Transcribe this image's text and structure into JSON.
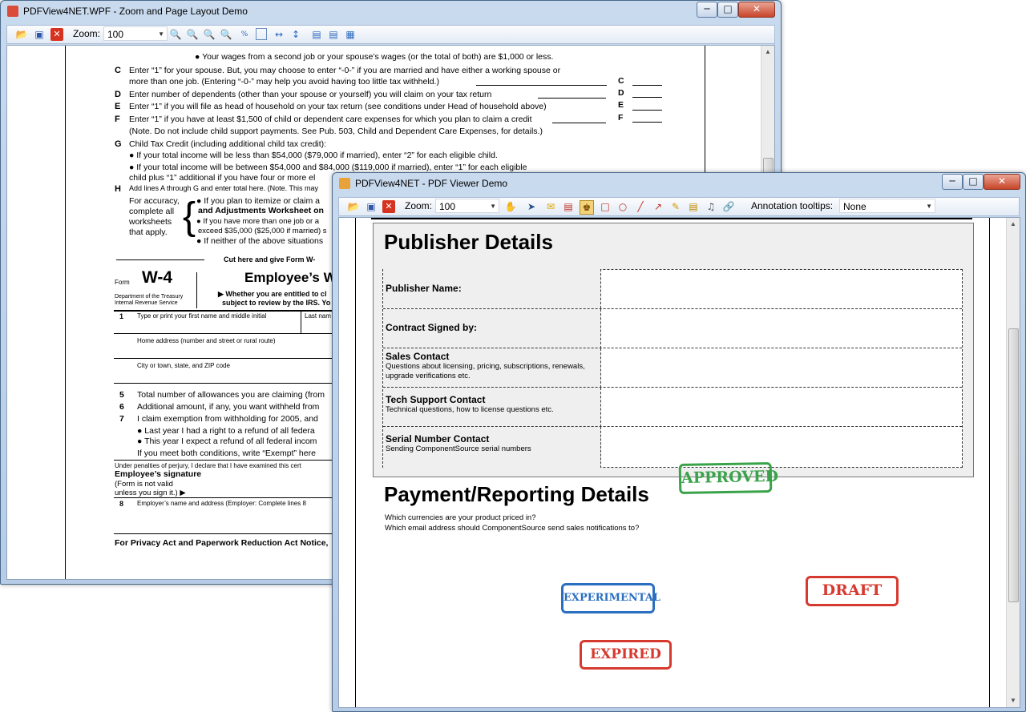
{
  "back_window": {
    "title": "PDFView4NET.WPF - Zoom and Page Layout Demo",
    "controls": {
      "minimize": "─",
      "maximize": "□",
      "close": "✕"
    },
    "toolbar": {
      "zoom_label": "Zoom:",
      "zoom_value": "100"
    },
    "w4": {
      "top_line": "●  Your wages from a second job or your spouse’s wages (or the total of both) are $1,000 or less.",
      "C1": "Enter “1” for your spouse. But, you may choose to enter “-0-” if you are married and have either a working spouse or",
      "C2": "more than one job. (Entering “-0-” may help you avoid having too little tax withheld.)",
      "D": "Enter number of dependents (other than your spouse or yourself) you will claim on your tax return",
      "E": "Enter “1” if you will file as head of household on your tax return (see conditions under Head of household above)",
      "F1": "Enter “1” if you have at least $1,500 of child or dependent care expenses for which you plan to claim a credit",
      "F2": "(Note. Do not include child support payments. See Pub. 503, Child and Dependent Care Expenses, for details.)",
      "G1": "Child Tax Credit (including additional child tax credit):",
      "G2": "●  If your total income will be less than $54,000 ($79,000 if married), enter “2” for each eligible child.",
      "G3": "●  If your total income will be between $54,000 and $84,000 ($119,000 if married), enter “1” for each eligible",
      "G4": "child plus “1” additional if you have four or more el",
      "H": "Add lines A through G and enter total here. (Note. This may",
      "acc1": "For accuracy,",
      "acc2": "complete all",
      "acc3": "worksheets",
      "acc4": "that apply.",
      "b1": "● If you plan to itemize or claim a",
      "b1b": "and Adjustments Worksheet on",
      "b2": "● If you have more than one job or a",
      "b2b": "exceed $35,000 ($25,000 if married) s",
      "b3": "● If neither of the above situations",
      "cut": "Cut here and give Form W-",
      "form_word": "Form",
      "form_id": "W-4",
      "form_title": "Employee’s W",
      "dept1": "Department of the Treasury",
      "dept2": "Internal Revenue Service",
      "whether1": "▶  Whether you are entitled to cl",
      "whether2": "subject to review by the IRS. Yo",
      "f1": "Type or print your first name and middle initial",
      "f1b": "Last nam",
      "home": "Home address (number and street or rural route)",
      "city": "City or town, state, and ZIP code",
      "l5": "Total number of allowances you are claiming (from",
      "l6": "Additional amount, if any, you want withheld from",
      "l7": "I claim exemption from withholding for 2005, and",
      "l7a": "● Last year I had a right to a refund of all federa",
      "l7b": "● This year I expect a refund of all federal incom",
      "l7c": "If you meet both conditions, write “Exempt” here",
      "perjury": "Under penalties of perjury, I declare that I have examined this cert",
      "sig": "Employee’s signature",
      "sig2": "(Form is not valid",
      "sig3": "unless you sign it.)  ▶",
      "l8": "Employer’s name and address (Employer: Complete lines 8",
      "privacy": "For Privacy Act and Paperwork Reduction Act Notice,",
      "letters": [
        "C",
        "D",
        "E",
        "F",
        "G",
        "H"
      ],
      "line_nums": [
        "1",
        "5",
        "6",
        "7",
        "8"
      ],
      "box_letters": [
        "C",
        "D",
        "E",
        "F"
      ]
    }
  },
  "front_window": {
    "title": "PDFView4NET - PDF Viewer Demo",
    "controls": {
      "minimize": "─",
      "maximize": "□",
      "close": "✕"
    },
    "toolbar": {
      "zoom_label": "Zoom:",
      "zoom_value": "100",
      "tooltips_label": "Annotation tooltips:",
      "tooltips_value": "None"
    },
    "doc": {
      "publisher_heading": "Publisher Details",
      "rows": [
        {
          "label": "Publisher Name:",
          "desc": ""
        },
        {
          "label": "Contract Signed by:",
          "desc": ""
        },
        {
          "label": "Sales Contact",
          "desc": "Questions about licensing, pricing, subscriptions, renewals, upgrade verifications etc."
        },
        {
          "label": "Tech Support Contact",
          "desc": "Technical questions, how to license questions etc."
        },
        {
          "label": "Serial Number Contact",
          "desc": "Sending ComponentSource serial numbers"
        }
      ],
      "payment_heading": "Payment/Reporting Details",
      "q1": "Which currencies are your product priced in?",
      "q2": "Which email address should ComponentSource send sales notifications to?",
      "stamps": {
        "approved": "APPROVED",
        "experimental": "EXPERIMENTAL",
        "draft": "DRAFT",
        "expired": "EXPIRED"
      }
    }
  },
  "colors": {
    "stamp_green": "#3aa34a",
    "stamp_blue": "#2a6fc0",
    "stamp_red": "#d63a2f"
  }
}
